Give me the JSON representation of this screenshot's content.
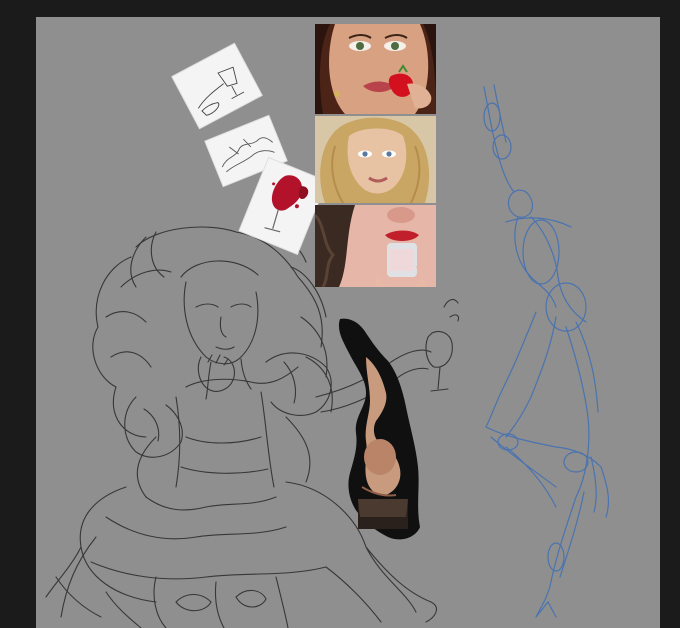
{
  "app": {
    "background_color": "#1b1b1b",
    "canvas_color": "#8f8f8f"
  },
  "canvas": {
    "layers": [
      {
        "name": "line-art-sketch",
        "stroke": "#2e2e2e"
      },
      {
        "name": "gesture-construction-sketch",
        "stroke": "#3f6fb5"
      }
    ]
  },
  "references": {
    "photo_strip": [
      {
        "subject": "face-with-strawberry"
      },
      {
        "subject": "blonde-portrait"
      },
      {
        "subject": "lips-with-glass"
      }
    ],
    "cards": [
      {
        "subject": "hand-with-glass-sketch"
      },
      {
        "subject": "sketch-card"
      },
      {
        "subject": "red-splash-glass"
      }
    ],
    "cutout": {
      "subject": "figure-pose-reference"
    }
  }
}
